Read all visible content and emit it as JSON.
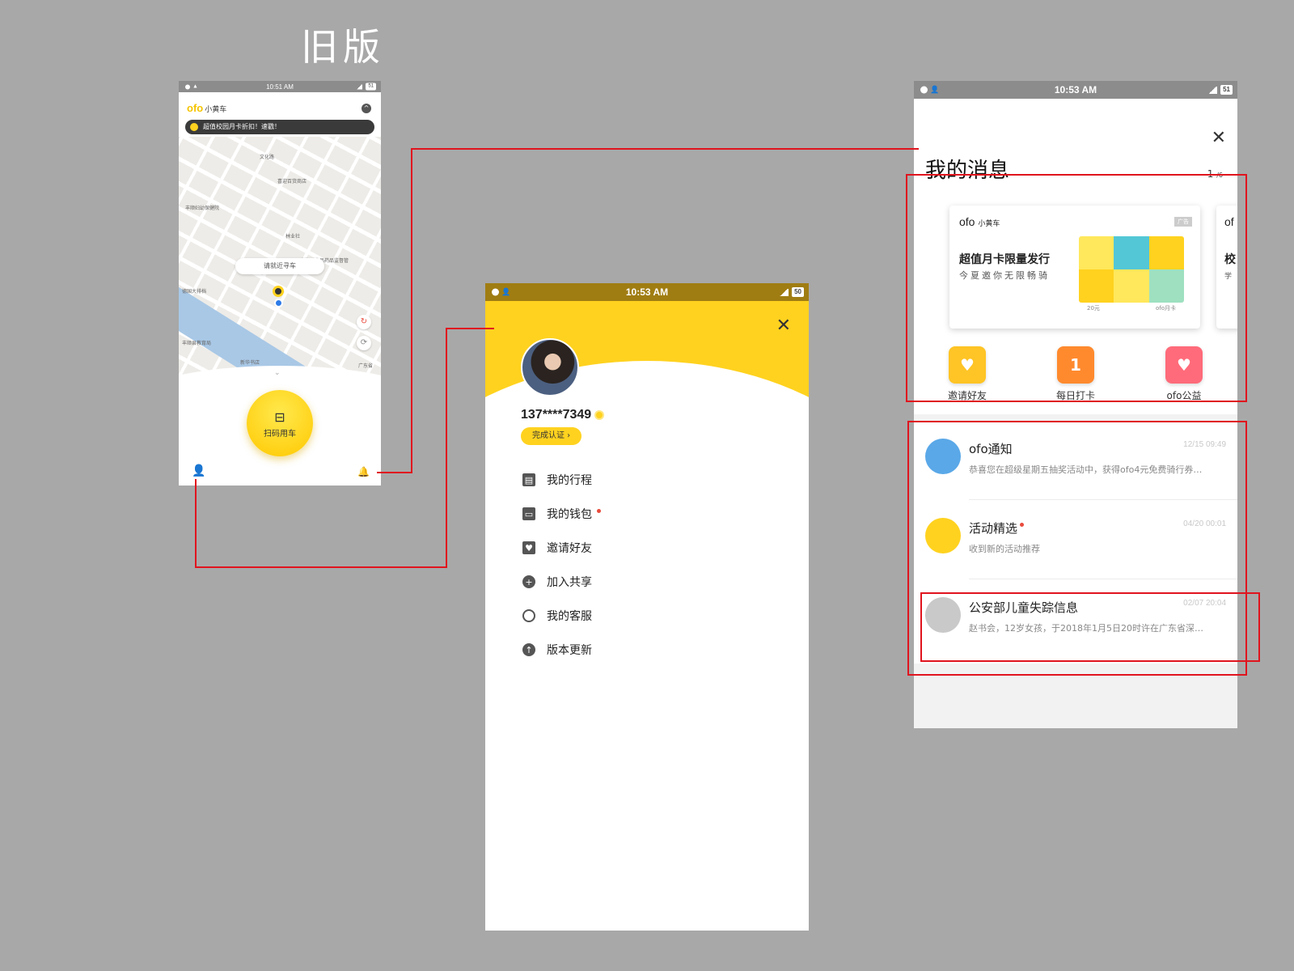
{
  "title": "旧版",
  "phone1": {
    "status": {
      "time": "10:51 AM",
      "battery": "51"
    },
    "logo": {
      "brand": "ofo",
      "name": "小黄车"
    },
    "banner": "超值校园月卡折扣！速戳！",
    "map_labels": [
      "文化路",
      "喜迎百货商店",
      "丰顺妇幼保健院",
      "请就近寻车",
      "林业社",
      "丰顺县食品药品监督管理局",
      "德国大排档",
      "丰顺县教育局",
      "新华书店",
      "广东省"
    ],
    "bubble": "请就近寻车",
    "scan_label": "扫码用车"
  },
  "phone2": {
    "status": {
      "time": "10:53 AM",
      "battery": "50"
    },
    "phone_number": "137****7349",
    "cert_label": "完成认证 ›",
    "menu": [
      {
        "label": "我的行程",
        "icon": "calendar-icon",
        "dot": false
      },
      {
        "label": "我的钱包",
        "icon": "wallet-icon",
        "dot": true
      },
      {
        "label": "邀请好友",
        "icon": "gift-envelope-icon",
        "dot": false
      },
      {
        "label": "加入共享",
        "icon": "plus-circle-icon",
        "dot": false
      },
      {
        "label": "我的客服",
        "icon": "headset-icon",
        "dot": false
      },
      {
        "label": "版本更新",
        "icon": "arrow-up-circle-icon",
        "dot": false
      }
    ]
  },
  "phone3": {
    "status": {
      "time": "10:53 AM",
      "battery": "51"
    },
    "title": "我的消息",
    "page_current": "1",
    "page_total": "/6",
    "card": {
      "brand": "ofo",
      "brand_name": "小黄车",
      "ad": "广告",
      "headline": "超值月卡限量发行",
      "sub": "今夏邀你无限畅骑",
      "price": "20元",
      "product": "ofo月卡"
    },
    "card2": {
      "brand": "of",
      "headline": "校",
      "sub": "学"
    },
    "quick": [
      {
        "label": "邀请好友",
        "color": "#ffc425"
      },
      {
        "label": "每日打卡",
        "color": "#ff8a2e",
        "glyph": "1"
      },
      {
        "label": "ofo公益",
        "color": "#ff6b7a"
      }
    ],
    "messages": [
      {
        "title": "ofo通知",
        "date": "12/15 09:49",
        "summary": "恭喜您在超级星期五抽奖活动中，获得ofo4元免费骑行券…",
        "dot": false
      },
      {
        "title": "活动精选",
        "date": "04/20 00:01",
        "summary": "收到新的活动推荐",
        "dot": true
      },
      {
        "title": "公安部儿童失踪信息",
        "date": "02/07 20:04",
        "summary": "赵书会，12岁女孩，于2018年1月5日20时许在广东省深…",
        "dot": false
      }
    ]
  },
  "colors": {
    "brand_yellow": "#ffd21f",
    "annotation_red": "#e0141e",
    "background": "#a8a8a8"
  }
}
